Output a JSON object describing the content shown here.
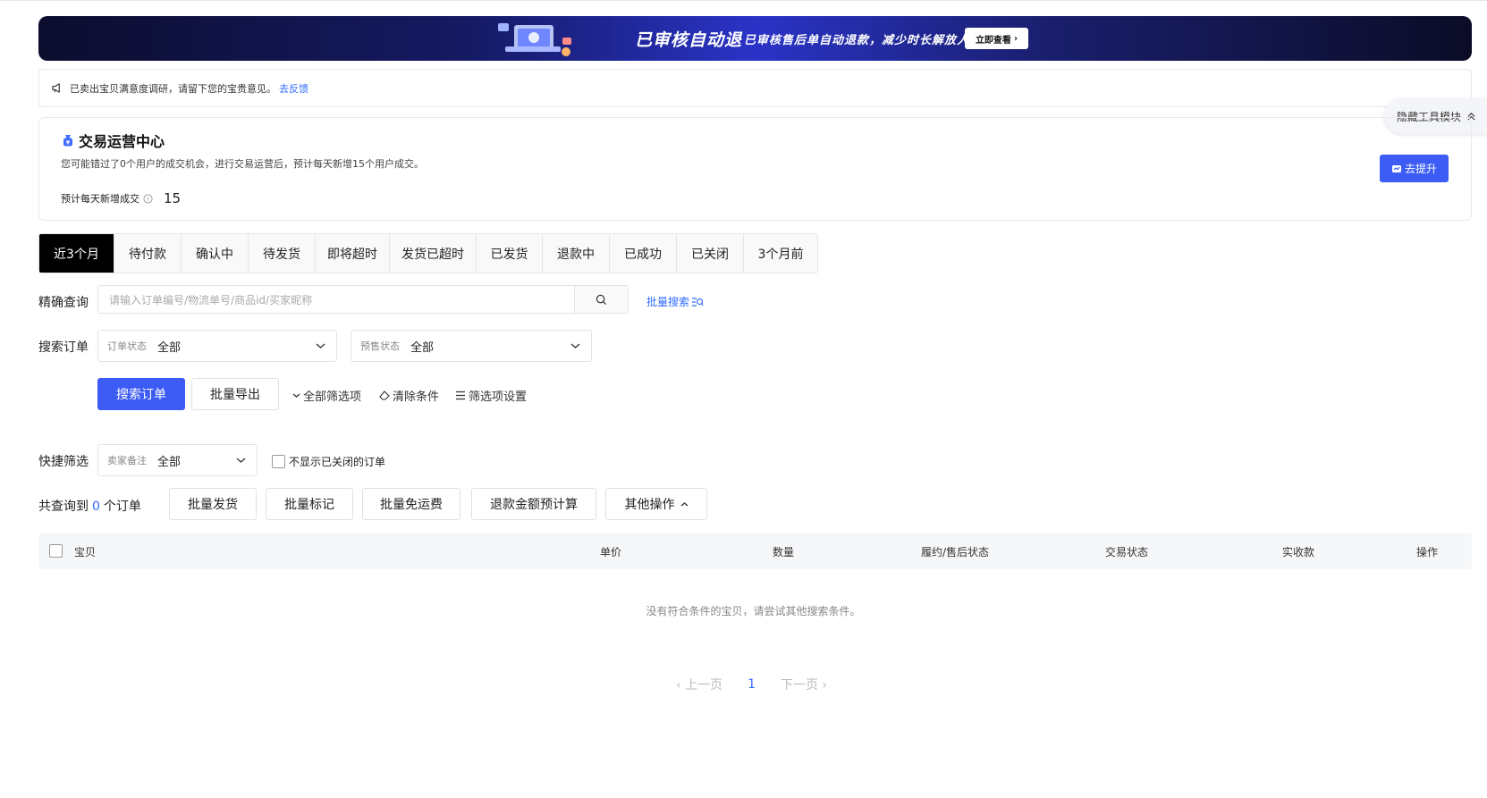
{
  "banner": {
    "title": "已审核自动退",
    "subtitle": "已审核售后单自动退款，减少时长解放人力",
    "cta_label": "立即查看"
  },
  "notice": {
    "text": "已卖出宝贝满意度调研，请留下您的宝贵意见。",
    "link_label": "去反馈"
  },
  "hide_tools_label": "隐藏工具模块",
  "ops_center": {
    "title": "交易运营中心",
    "desc": "您可能错过了0个用户的成交机会，进行交易运营后，预计每天新增15个用户成交。",
    "metric_label": "预计每天新增成交",
    "metric_value": "15",
    "button_label": "去提升"
  },
  "tabs": [
    {
      "label": "近3个月",
      "active": true
    },
    {
      "label": "待付款"
    },
    {
      "label": "确认中"
    },
    {
      "label": "待发货"
    },
    {
      "label": "即将超时"
    },
    {
      "label": "发货已超时"
    },
    {
      "label": "已发货"
    },
    {
      "label": "退款中"
    },
    {
      "label": "已成功"
    },
    {
      "label": "已关闭"
    },
    {
      "label": "3个月前"
    }
  ],
  "precise_search": {
    "label": "精确查询",
    "placeholder": "请输入订单编号/物流单号/商品id/买家昵称",
    "bulk_label": "批量搜索"
  },
  "order_search": {
    "label": "搜索订单",
    "order_status_label": "订单状态",
    "order_status_value": "全部",
    "presale_status_label": "预售状态",
    "presale_status_value": "全部"
  },
  "actions": {
    "search_button": "搜索订单",
    "export_button": "批量导出",
    "all_filters": "全部筛选项",
    "clear_conditions": "清除条件",
    "filter_settings": "筛选项设置"
  },
  "quick_filter": {
    "label": "快捷筛选",
    "seller_note_label": "卖家备注",
    "seller_note_value": "全部",
    "hide_closed_label": "不显示已关闭的订单"
  },
  "result": {
    "prefix": "共查询到",
    "count": "0",
    "suffix": "个订单",
    "buttons": [
      "批量发货",
      "批量标记",
      "批量免运费",
      "退款金额预计算",
      "其他操作"
    ]
  },
  "table": {
    "columns": [
      "宝贝",
      "单价",
      "数量",
      "履约/售后状态",
      "交易状态",
      "实收款",
      "操作"
    ],
    "empty_text": "没有符合条件的宝贝，请尝试其他搜索条件。"
  },
  "pagination": {
    "prev": "上一页",
    "current": "1",
    "next": "下一页"
  },
  "colors": {
    "primary": "#3d5cf5",
    "link": "#2f6bff"
  }
}
